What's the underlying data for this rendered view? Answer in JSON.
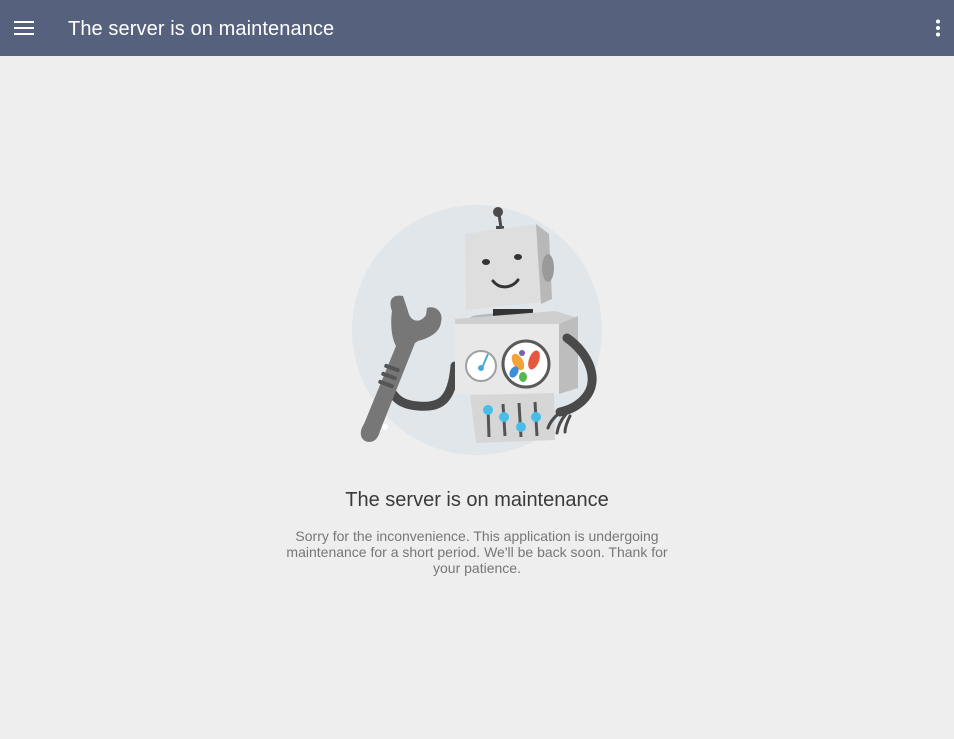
{
  "app_bar": {
    "title": "The server is on maintenance",
    "menu_icon": "hamburger-menu-icon",
    "more_icon": "more-vertical-icon",
    "background_color": "#56617e"
  },
  "main": {
    "illustration": "robot-with-wrench-illustration",
    "heading": "The server is on maintenance",
    "message": "Sorry for the inconvenience. This application is undergoing maintenance for a short period. We'll be back soon. Thank for your patience."
  }
}
